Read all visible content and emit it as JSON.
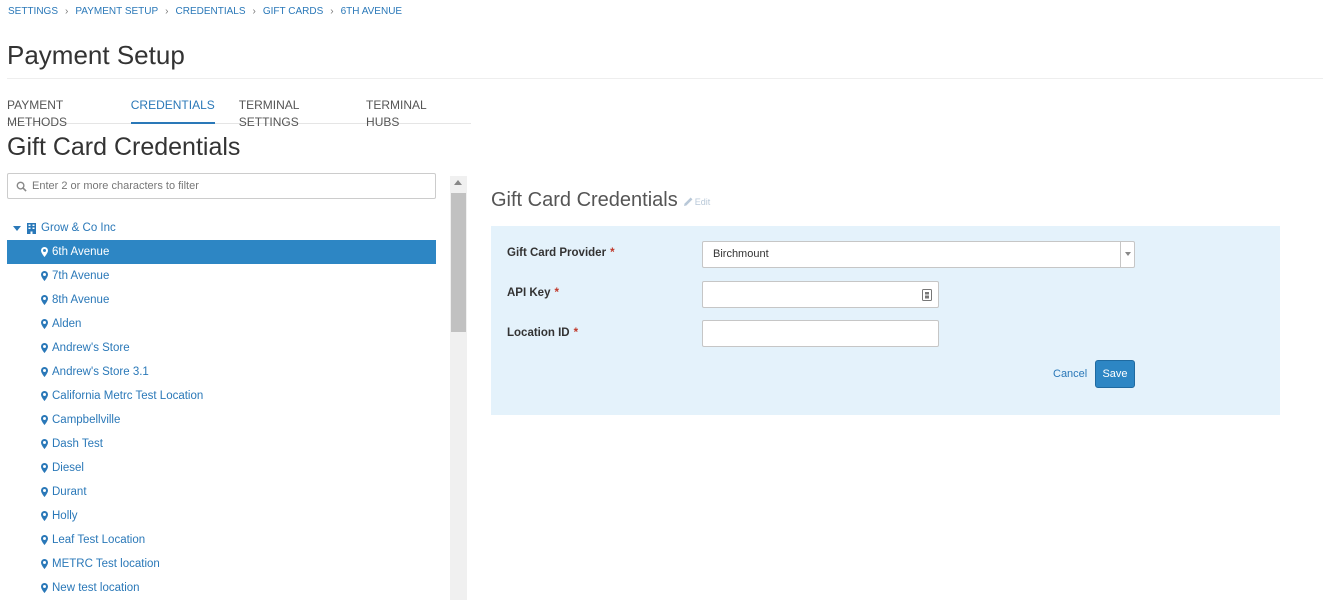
{
  "breadcrumb": [
    "SETTINGS",
    "PAYMENT SETUP",
    "CREDENTIALS",
    "GIFT CARDS",
    "6TH AVENUE"
  ],
  "page_title": "Payment Setup",
  "tabs": [
    {
      "label": "PAYMENT METHODS",
      "active": false
    },
    {
      "label": "CREDENTIALS",
      "active": true
    },
    {
      "label": "TERMINAL SETTINGS",
      "active": false
    },
    {
      "label": "TERMINAL HUBS",
      "active": false
    }
  ],
  "section_title": "Gift Card Credentials",
  "filter": {
    "placeholder": "Enter 2 or more characters to filter",
    "value": ""
  },
  "tree": {
    "root": "Grow & Co Inc",
    "selected_index": 0,
    "locations": [
      "6th Avenue",
      "7th Avenue",
      "8th Avenue",
      "Alden",
      "Andrew's Store",
      "Andrew's Store 3.1",
      "California Metrc Test Location",
      "Campbellville",
      "Dash Test",
      "Diesel",
      "Durant",
      "Holly",
      "Leaf Test Location",
      "METRC Test location",
      "New test location"
    ]
  },
  "form": {
    "title": "Gift Card Credentials",
    "edit_label": "Edit",
    "provider_label": "Gift Card Provider",
    "provider_value": "Birchmount",
    "api_key_label": "API Key",
    "api_key_value": "",
    "location_id_label": "Location ID",
    "location_id_value": "",
    "required_mark": "*",
    "cancel_label": "Cancel",
    "save_label": "Save"
  },
  "colors": {
    "accent": "#2a78b8",
    "selected_bg": "#2d86c4",
    "panel_bg": "#e4f2fb",
    "required": "#c0392b"
  }
}
